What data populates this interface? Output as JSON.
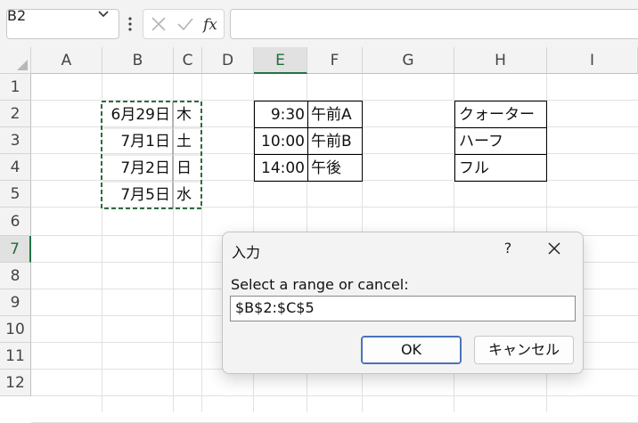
{
  "formula_bar": {
    "name_box": "B2",
    "formula": ""
  },
  "columns": [
    "A",
    "B",
    "C",
    "D",
    "E",
    "F",
    "G",
    "H",
    "I"
  ],
  "selected_column": "E",
  "rows": [
    "1",
    "2",
    "3",
    "4",
    "5",
    "6",
    "7",
    "8",
    "9",
    "10",
    "11",
    "12"
  ],
  "selected_row": "7",
  "cells": {
    "B2": "6月29日",
    "C2": "木",
    "B3": "7月1日",
    "C3": "土",
    "B4": "7月2日",
    "C4": "日",
    "B5": "7月5日",
    "C5": "水",
    "E2": "9:30",
    "F2": "午前A",
    "E3": "10:00",
    "F3": "午前B",
    "E4": "14:00",
    "F4": "午後",
    "H2": "クォーター",
    "H3": "ハーフ",
    "H4": "フル"
  },
  "dialog": {
    "title": "入力",
    "help": "?",
    "prompt": "Select a range or cancel:",
    "input_value": "$B$2:$C$5",
    "ok_label": "OK",
    "cancel_label": "キャンセル"
  },
  "colors": {
    "selection_green": "#217346",
    "marquee_green": "#2e6b3f",
    "ok_border": "#4a72b8"
  }
}
